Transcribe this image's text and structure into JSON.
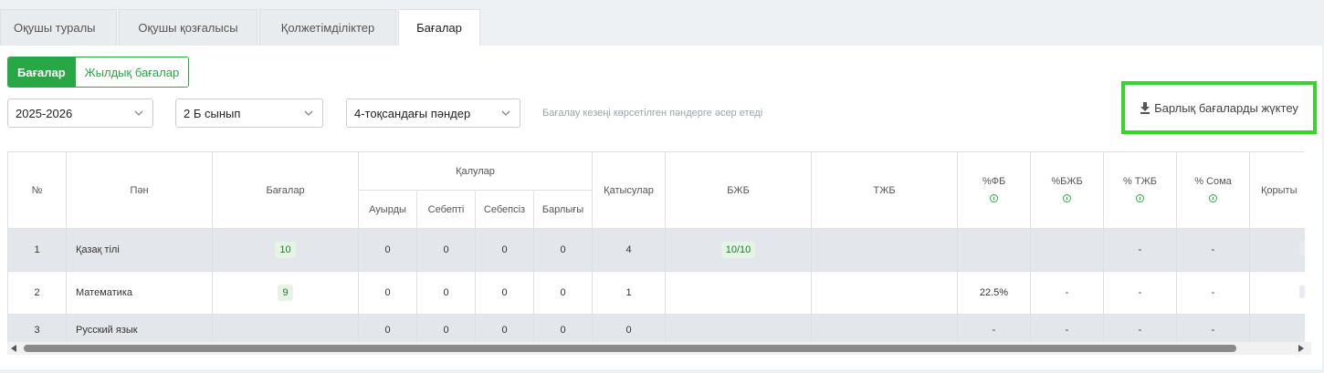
{
  "tabs": [
    "Оқушы туралы",
    "Оқушы қозғалысы",
    "Қолжетімділіктер",
    "Бағалар"
  ],
  "segment": {
    "grades": "Бағалар",
    "yearly": "Жылдық бағалар"
  },
  "filters": {
    "year": "2025-2026",
    "class": "2 Б сынып",
    "subjects": "4-тоқсандағы пәндер"
  },
  "note": "Бағалау кезеңі көрсетілген пәндерге әсер етеді",
  "download_label": "Барлық бағаларды жүктеу",
  "table": {
    "h_no": "№",
    "h_subject": "Пән",
    "h_grades": "Бағалар",
    "h_absences": "Қалулар",
    "h_sick": "Ауырды",
    "h_excused": "Себепті",
    "h_unexcused": "Себепсіз",
    "h_total": "Барлығы",
    "h_attend": "Қатысулар",
    "h_bzb": "БЖБ",
    "h_tzb": "ТЖБ",
    "h_pfb": "%ФБ",
    "h_pbzb": "%БЖБ",
    "h_ptzb": "% ТЖБ",
    "h_psum": "% Сома",
    "h_final": "Қорыты",
    "rows": [
      {
        "no": "1",
        "subject": "Қазақ тілі",
        "grade": "10",
        "sick": "0",
        "excused": "0",
        "unexcused": "0",
        "total": "0",
        "attend": "4",
        "bzb": "10/10",
        "tzb": "",
        "pfb": "",
        "pbzb": "",
        "ptzb": "-",
        "psum": "-"
      },
      {
        "no": "2",
        "subject": "Математика",
        "grade": "9",
        "sick": "0",
        "excused": "0",
        "unexcused": "0",
        "total": "0",
        "attend": "1",
        "bzb": "",
        "tzb": "",
        "pfb": "22.5%",
        "pbzb": "-",
        "ptzb": "-",
        "psum": "-"
      },
      {
        "no": "3",
        "subject": "Русский язык",
        "grade": "",
        "sick": "0",
        "excused": "0",
        "unexcused": "0",
        "total": "0",
        "attend": "0",
        "bzb": "",
        "tzb": "",
        "pfb": "-",
        "pbzb": "-",
        "ptzb": "-",
        "psum": "-"
      }
    ]
  }
}
